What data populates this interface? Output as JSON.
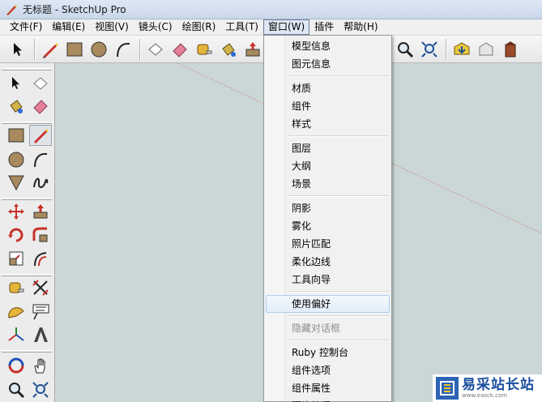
{
  "window": {
    "title": "无标题 - SketchUp Pro"
  },
  "menubar": [
    {
      "label": "文件(F)"
    },
    {
      "label": "编辑(E)"
    },
    {
      "label": "视图(V)"
    },
    {
      "label": "镜头(C)"
    },
    {
      "label": "绘图(R)"
    },
    {
      "label": "工具(T)"
    },
    {
      "label": "窗口(W)",
      "open": true
    },
    {
      "label": "插件"
    },
    {
      "label": "帮助(H)"
    }
  ],
  "window_menu": {
    "items": [
      {
        "label": "模型信息"
      },
      {
        "label": "图元信息"
      },
      {
        "label": "材质"
      },
      {
        "label": "组件"
      },
      {
        "label": "样式"
      },
      {
        "label": "图层"
      },
      {
        "label": "大纲"
      },
      {
        "label": "场景"
      },
      {
        "label": "阴影"
      },
      {
        "label": "雾化"
      },
      {
        "label": "照片匹配"
      },
      {
        "label": "柔化边线"
      },
      {
        "label": "工具向导"
      },
      {
        "label": "使用偏好",
        "highlighted": true
      },
      {
        "label": "隐藏对话框",
        "disabled": true
      },
      {
        "label": "Ruby 控制台"
      },
      {
        "label": "组件选项"
      },
      {
        "label": "组件属性"
      },
      {
        "label": "照片纹理"
      }
    ]
  },
  "toolbar_icons": [
    "select-icon",
    "pencil-icon",
    "rectangle-icon",
    "circle-icon",
    "arc-icon",
    "eraser-outline-icon",
    "eraser-icon",
    "tape-measure-icon",
    "paint-bucket-icon",
    "push-pull-icon",
    "orbit-icon",
    "search-icon",
    "zoom-extents-icon",
    "warehouse-icon",
    "share-icon",
    "building-icon"
  ],
  "watermark": {
    "brand": "易采站长站",
    "url": "www.easck.com"
  },
  "colors": {
    "canvas": "#cbd7d6",
    "menu_bg": "#f1f1f1",
    "highlight": "#dce9f8",
    "sketch_tan": "#a88a5e"
  }
}
